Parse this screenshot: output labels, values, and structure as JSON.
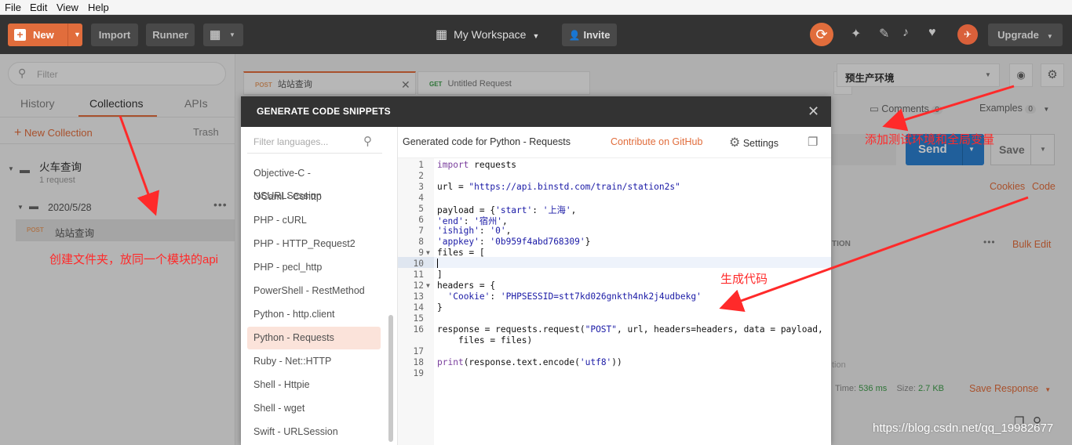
{
  "menu": [
    "File",
    "Edit",
    "View",
    "Help"
  ],
  "header": {
    "new_label": "New",
    "import_label": "Import",
    "runner_label": "Runner",
    "workspace_label": "My Workspace",
    "invite_label": "Invite",
    "upgrade_label": "Upgrade"
  },
  "sidebar": {
    "filter_placeholder": "Filter",
    "tabs": [
      "History",
      "Collections",
      "APIs"
    ],
    "new_collection": "New Collection",
    "trash": "Trash",
    "collection_name": "火车查询",
    "collection_count": "1 request",
    "folder_name": "2020/5/28",
    "request_method": "POST",
    "request_name": "站站查询"
  },
  "request_tabs": [
    {
      "method": "POST",
      "name": "站站查询"
    },
    {
      "method": "GET",
      "name": "Untitled Request"
    }
  ],
  "right": {
    "environment": "预生产环境",
    "comments": "Comments",
    "comments_count": "0",
    "examples": "Examples",
    "examples_count": "0",
    "send": "Send",
    "save": "Save",
    "cookies": "Cookies",
    "code": "Code",
    "bulk_edit": "Bulk Edit",
    "col_description": "TION",
    "partial_tion": "tion",
    "time": "Time:",
    "time_value": "536 ms",
    "size": "Size:",
    "size_value": "2.7 KB",
    "save_response": "Save Response"
  },
  "modal": {
    "title": "GENERATE CODE SNIPPETS",
    "filter_placeholder": "Filter languages...",
    "languages": [
      "Objective-C - NSURLSession",
      "OCaml - Cohttp",
      "PHP - cURL",
      "PHP - HTTP_Request2",
      "PHP - pecl_http",
      "PowerShell - RestMethod",
      "Python - http.client",
      "Python - Requests",
      "Ruby - Net::HTTP",
      "Shell - Httpie",
      "Shell - wget",
      "Swift - URLSession"
    ],
    "selected_language": "Python - Requests",
    "generated_for": "Generated code for Python - Requests",
    "contribute": "Contribute on GitHub",
    "settings": "Settings",
    "code_lines": [
      {
        "n": "1",
        "t": "import requests"
      },
      {
        "n": "2",
        "t": ""
      },
      {
        "n": "3",
        "t": "url = \"https://api.binstd.com/train/station2s\""
      },
      {
        "n": "4",
        "t": ""
      },
      {
        "n": "5",
        "t": "payload = {'start': '上海',"
      },
      {
        "n": "6",
        "t": "'end': '宿州',"
      },
      {
        "n": "7",
        "t": "'ishigh': '0',"
      },
      {
        "n": "8",
        "t": "'appkey': '0b959f4abd768309'}"
      },
      {
        "n": "9",
        "t": "files = ["
      },
      {
        "n": "10",
        "t": ""
      },
      {
        "n": "11",
        "t": "]"
      },
      {
        "n": "12",
        "t": "headers = {"
      },
      {
        "n": "13",
        "t": "  'Cookie': 'PHPSESSID=stt7kd026gnkth4nk2j4udbekg'"
      },
      {
        "n": "14",
        "t": "}"
      },
      {
        "n": "15",
        "t": ""
      },
      {
        "n": "16",
        "t": "response = requests.request(\"POST\", url, headers=headers, data = payload,"
      },
      {
        "n": "",
        "t": "    files = files)"
      },
      {
        "n": "17",
        "t": ""
      },
      {
        "n": "18",
        "t": "print(response.text.encode('utf8'))"
      },
      {
        "n": "19",
        "t": ""
      }
    ]
  },
  "annotations": {
    "folder_note": "创建文件夹，放同一个模块的api",
    "env_note": "添加测试环境和全局变量",
    "code_note": "生成代码"
  },
  "watermark": "https://blog.csdn.net/qq_19982677",
  "colors": {
    "accent": "#e16d3c",
    "header_bg": "#333333",
    "send": "#2b7fcf",
    "annotation": "#ff2a2a"
  }
}
